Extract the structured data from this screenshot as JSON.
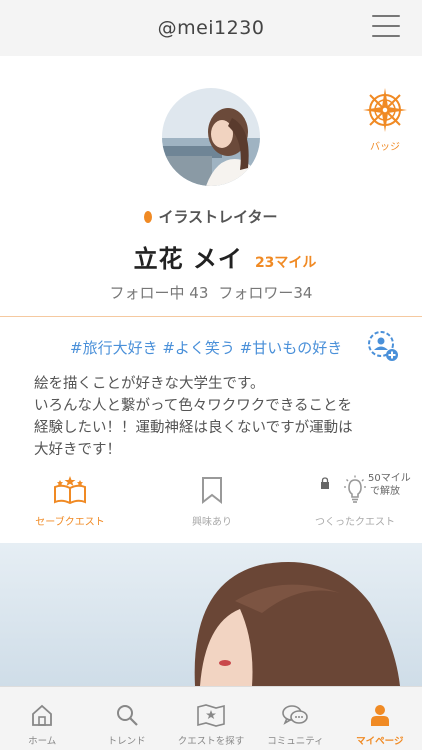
{
  "header": {
    "title": "@mei1230"
  },
  "profile": {
    "badge_label": "バッジ",
    "role": "イラストレイター",
    "name": "立花 メイ",
    "miles": "23マイル",
    "following": "フォロー中 43",
    "followers": "フォロワー34"
  },
  "bio": {
    "tags": [
      "#旅行大好き",
      "#よく笑う",
      "#甘いもの好き"
    ],
    "lines": [
      "絵を描くことが好きな大学生です。",
      "いろんな人と繋がって色々ワクワクできることを",
      "経験したい！！運動神経は良くないですが運動は",
      "大好きです！"
    ]
  },
  "actions": {
    "save_quest": "セーブクエスト",
    "interested": "興味あり",
    "created_quest": "つくったクエスト",
    "unlock_miles": "50マイル",
    "unlock_text": "で解放"
  },
  "tabs": [
    {
      "label": "ホーム",
      "icon": "home-icon"
    },
    {
      "label": "トレンド",
      "icon": "search-icon"
    },
    {
      "label": "クエストを探す",
      "icon": "map-icon"
    },
    {
      "label": "コミュニティ",
      "icon": "chat-icon"
    },
    {
      "label": "マイページ",
      "icon": "person-icon",
      "active": true
    }
  ],
  "colors": {
    "accent": "#f08a24",
    "tag": "#4a90d9",
    "divider": "#f5c9a0"
  }
}
